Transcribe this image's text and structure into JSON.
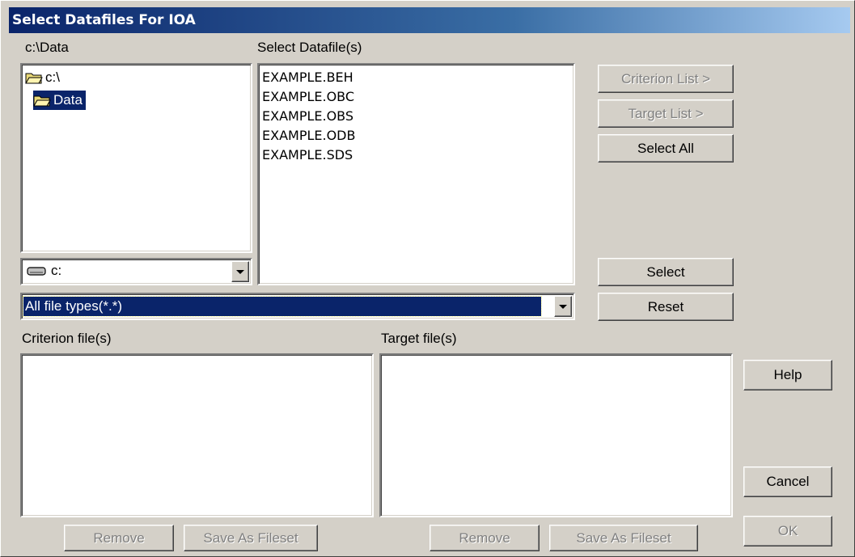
{
  "window": {
    "title": "Select Datafiles For IOA"
  },
  "left": {
    "path_label": "c:\\Data",
    "tree": [
      {
        "label": "c:\\",
        "icon": "open-folder-icon",
        "selected": false
      },
      {
        "label": "Data",
        "icon": "open-folder-icon",
        "selected": true
      }
    ],
    "drive": {
      "value": "c:",
      "icon": "drive-icon"
    }
  },
  "datafiles": {
    "label": "Select Datafile(s)",
    "items": [
      "EXAMPLE.BEH",
      "EXAMPLE.OBC",
      "EXAMPLE.OBS",
      "EXAMPLE.ODB",
      "EXAMPLE.SDS"
    ]
  },
  "filetype": {
    "value": "All file types(*.*)"
  },
  "buttons": {
    "criterion_list": "Criterion List >",
    "target_list": "Target List >",
    "select_all": "Select All",
    "select": "Select",
    "reset": "Reset",
    "help": "Help",
    "cancel": "Cancel",
    "ok": "OK"
  },
  "criterion": {
    "label": "Criterion file(s)",
    "remove": "Remove",
    "save_as_fileset": "Save As Fileset"
  },
  "target": {
    "label": "Target file(s)",
    "remove": "Remove",
    "save_as_fileset": "Save As Fileset"
  },
  "colors": {
    "selection": "#0a246a",
    "face": "#d4d0c8",
    "disabled_text": "#808080"
  }
}
